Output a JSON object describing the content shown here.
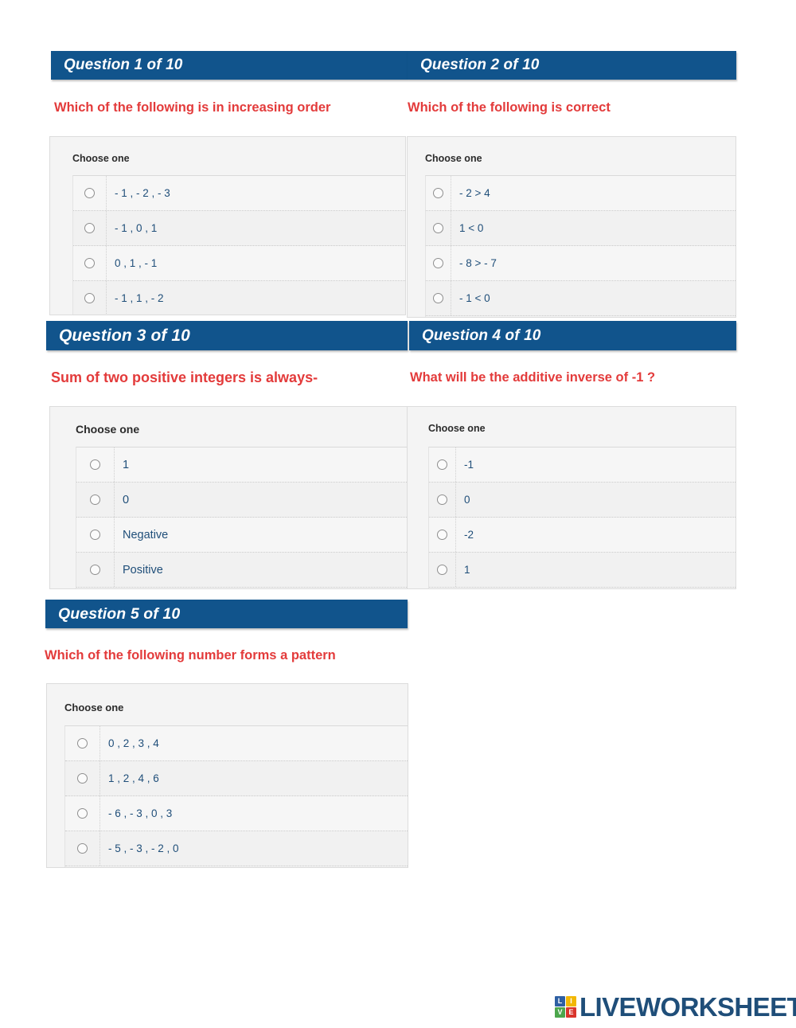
{
  "worksheet": {
    "choose_one_label": "Choose one",
    "accent_header_color": "#11548C",
    "prompt_color": "#E33B3B",
    "option_text_color": "#1F4E79"
  },
  "questions": [
    {
      "header": "Question 1 of 10",
      "prompt": "Which of the following is in increasing order",
      "choose_one": "Choose one",
      "options": [
        "- 1 , - 2 , - 3",
        "- 1 , 0 , 1",
        "0 , 1 , - 1",
        "- 1 , 1 , - 2"
      ]
    },
    {
      "header": "Question 2 of 10",
      "prompt": "Which of the following is correct",
      "choose_one": "Choose one",
      "options": [
        "- 2 > 4",
        "1 < 0",
        "- 8 > - 7",
        "- 1 < 0"
      ]
    },
    {
      "header": "Question 3 of 10",
      "prompt": "Sum of two positive integers is always-",
      "choose_one": "Choose one",
      "options": [
        "1",
        "0",
        "Negative",
        "Positive"
      ]
    },
    {
      "header": "Question 4 of 10",
      "prompt": "What will be the additive inverse of -1 ?",
      "choose_one": "Choose one",
      "options": [
        "-1",
        "0",
        "-2",
        "1"
      ]
    },
    {
      "header": "Question 5 of 10",
      "prompt": "Which of the following number forms a pattern",
      "choose_one": "Choose one",
      "options": [
        "0 , 2 , 3 , 4",
        "1 , 2 , 4 , 6",
        "- 6 , - 3 , 0 , 3",
        "- 5 , - 3 , - 2 , 0"
      ]
    }
  ],
  "footer": {
    "brand_name": "LIVEWORKSHEETS",
    "logo_letters": [
      {
        "letter": "L",
        "color": "#2E5FA3"
      },
      {
        "letter": "I",
        "color": "#F2B705"
      },
      {
        "letter": "V",
        "color": "#4CA64C"
      },
      {
        "letter": "E",
        "color": "#D9342B"
      }
    ]
  }
}
